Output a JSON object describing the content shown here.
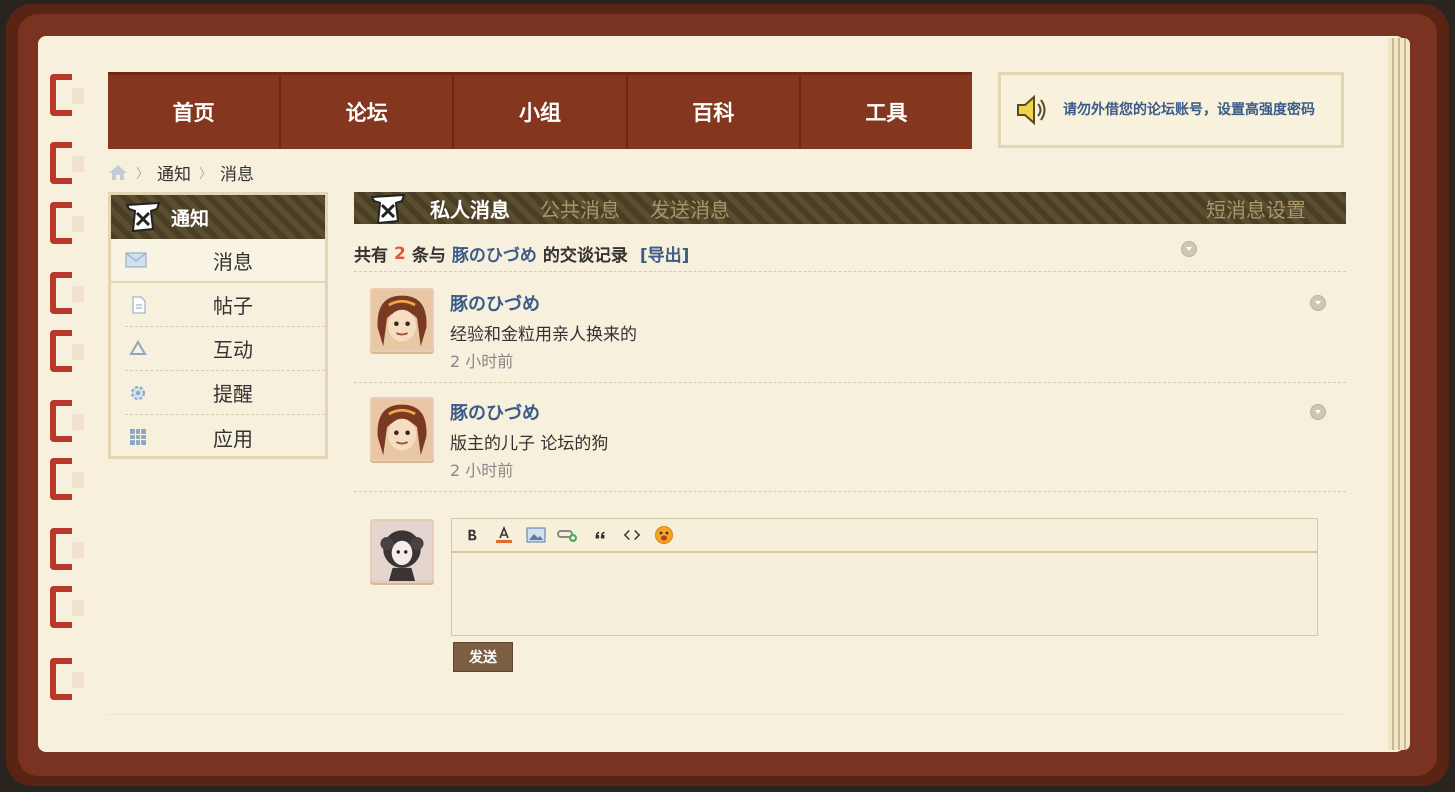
{
  "nav": {
    "items": [
      "首页",
      "论坛",
      "小组",
      "百科",
      "工具"
    ]
  },
  "notice": {
    "text": "请勿外借您的论坛账号，设置高强度密码",
    "icon": "speaker-icon"
  },
  "breadcrumb": {
    "items": [
      "通知",
      "消息"
    ]
  },
  "sidebar": {
    "title": "通知",
    "items": [
      {
        "label": "消息",
        "icon": "envelope-icon"
      },
      {
        "label": "帖子",
        "icon": "document-icon"
      },
      {
        "label": "互动",
        "icon": "recycle-icon"
      },
      {
        "label": "提醒",
        "icon": "gear-icon"
      },
      {
        "label": "应用",
        "icon": "grid-icon"
      }
    ]
  },
  "tabs": {
    "private": "私人消息",
    "public": "公共消息",
    "send": "发送消息",
    "settings": "短消息设置"
  },
  "summary": {
    "prefix": "共有",
    "count": "2",
    "middle": "条与",
    "peer": "豚のひづめ",
    "suffix": "的交谈记录",
    "export": "[导出]"
  },
  "messages": [
    {
      "name": "豚のひづめ",
      "body": "经验和金粒用亲人换来的",
      "time": "2 小时前"
    },
    {
      "name": "豚のひづめ",
      "body": "版主的儿子 论坛的狗",
      "time": "2 小时前"
    }
  ],
  "editor": {
    "send_label": "发送"
  },
  "colors": {
    "nav_bg": "#84361e",
    "link": "#3b5b8a",
    "count": "#e2583e",
    "paper": "#f7f0dc"
  }
}
